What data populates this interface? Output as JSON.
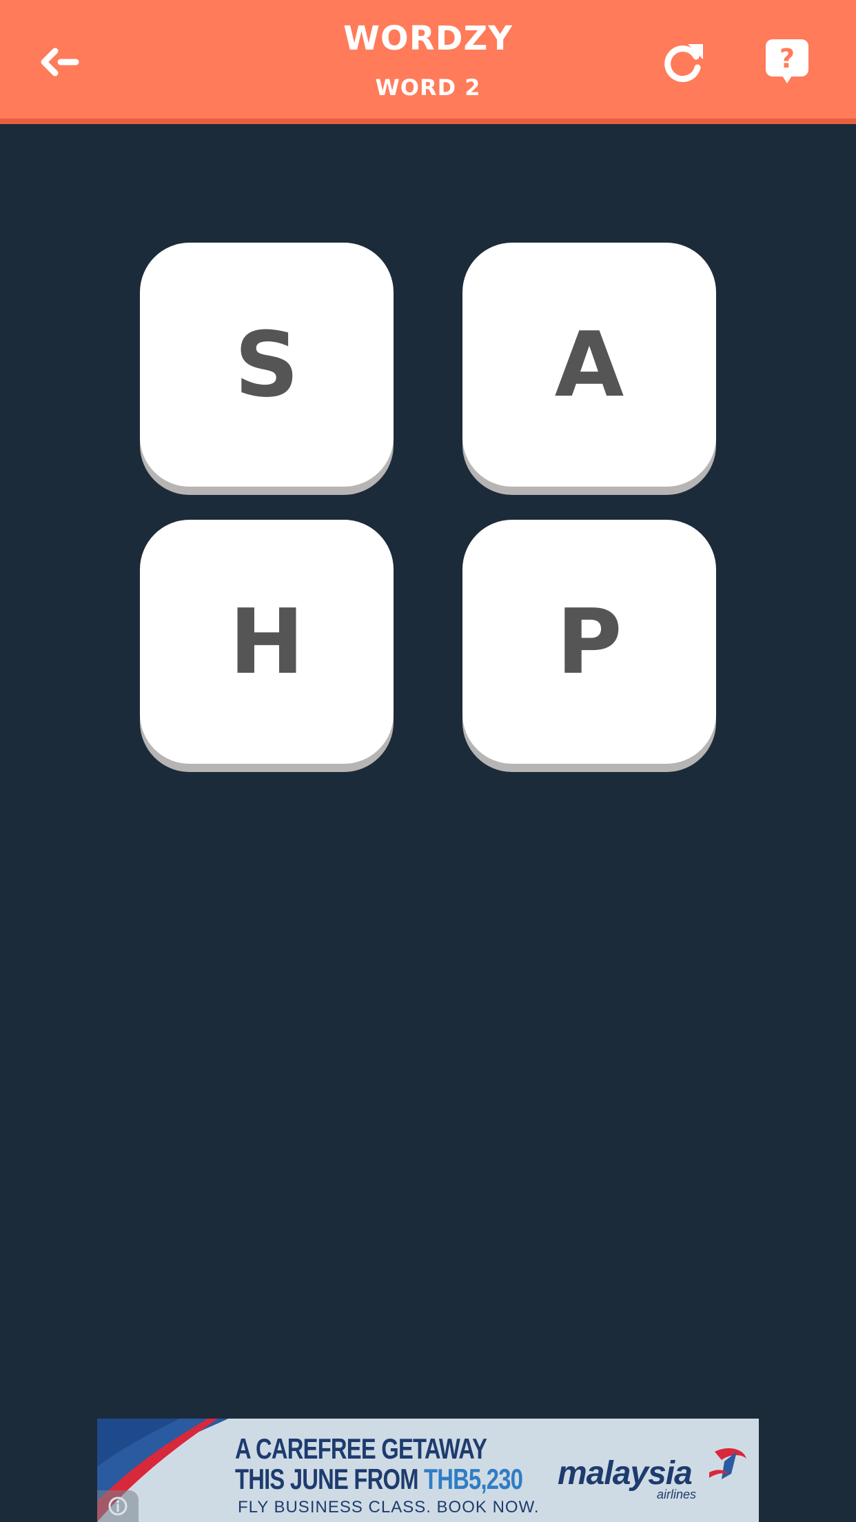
{
  "header": {
    "title": "WORDZY",
    "subtitle": "WORD 2",
    "back_icon": "back-arrow-icon",
    "refresh_icon": "refresh-icon",
    "hint_icon": "question-bubble-icon"
  },
  "tiles": [
    {
      "letter": "S"
    },
    {
      "letter": "A"
    },
    {
      "letter": "H"
    },
    {
      "letter": "P"
    }
  ],
  "ad": {
    "line1": "A CAREFREE GETAWAY",
    "line2_prefix": "THIS JUNE FROM ",
    "line2_price": "THB5,230",
    "line3": "FLY BUSINESS CLASS. BOOK NOW.",
    "brand": "malaysia",
    "brand_sub": "airlines",
    "info_icon": "info-icon"
  },
  "colors": {
    "header_bg": "#ff7b5a",
    "page_bg": "#1c2b3a",
    "tile_bg": "#ffffff",
    "tile_letter": "#555555",
    "ad_bg": "#cfdbe4",
    "ad_text": "#1d3b6e"
  }
}
